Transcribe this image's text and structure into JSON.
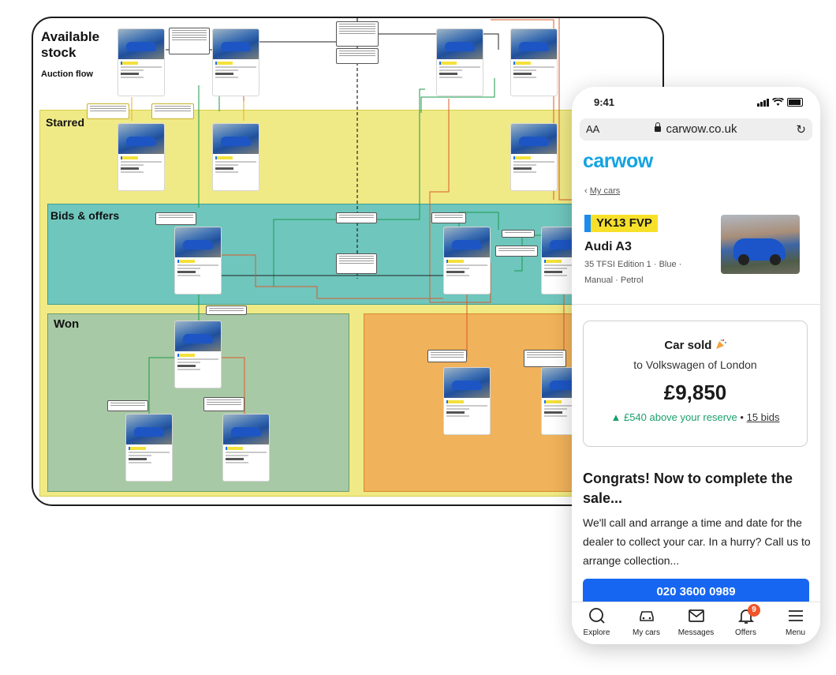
{
  "board": {
    "title_available": "Available stock",
    "title_auction": "Auction flow",
    "lanes": {
      "starred": "Starred",
      "bids": "Bids & offers",
      "won": "Won"
    }
  },
  "phone": {
    "time": "9:41",
    "url": "carwow.co.uk",
    "aa": "AA",
    "logo": "carwow",
    "breadcrumb": "My cars",
    "plate": "YK13 FVP",
    "model": "Audi A3",
    "spec": "35 TFSI Edition 1 · Blue · Manual · Petrol",
    "sold": {
      "title": "Car sold",
      "buyer": "to Volkswagen of London",
      "price": "£9,850",
      "above": "▲ £540 above your reserve",
      "separator": "•",
      "bids": "15 bids"
    },
    "congrats": "Congrats! Now to complete the sale...",
    "body": "We'll call and arrange a time and date for the dealer to collect your car. In a hurry? Call us to arrange collection...",
    "cta": "020 3600 0989",
    "tabs": {
      "explore": "Explore",
      "mycars": "My cars",
      "messages": "Messages",
      "offers": "Offers",
      "offers_badge": "9",
      "menu": "Menu"
    }
  },
  "colors": {
    "starred_lane": "#f0ea86",
    "bids_lane": "#6fc6bd",
    "won_lane": "#a8c9a5",
    "orange_lane": "#f0b25a",
    "brand": "#14a3e0",
    "cta": "#1666f1",
    "plate": "#f7e02a",
    "positive": "#1aa06d"
  }
}
